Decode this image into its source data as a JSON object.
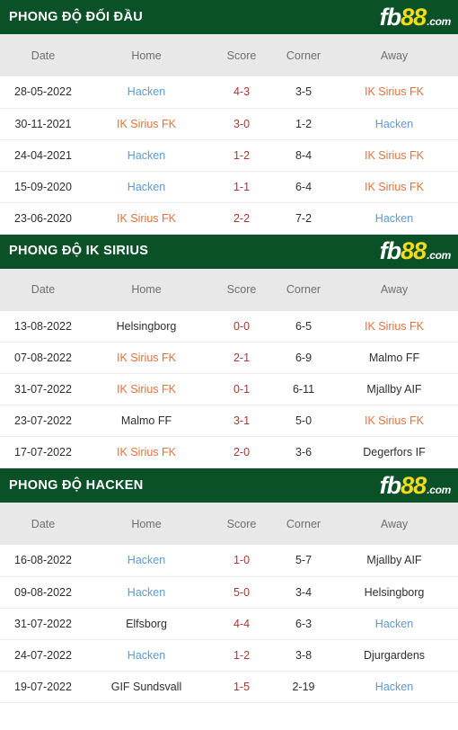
{
  "brand": {
    "logo_fb": "fb",
    "logo_88": "88",
    "logo_com": ".com",
    "green": "#0b5127",
    "yellow": "#f5dc16",
    "blue": "#5b9bd5",
    "orange": "#e4703c",
    "score_red": "#a33a33"
  },
  "columns": {
    "date": "Date",
    "home": "Home",
    "score": "Score",
    "corner": "Corner",
    "away": "Away"
  },
  "sections": [
    {
      "title": "PHONG ĐỘ ĐỐI ĐẦU",
      "rows": [
        {
          "date": "28-05-2022",
          "home": "Hacken",
          "home_style": "t-blue",
          "score": "4-3",
          "corner": "3-5",
          "away": "IK Sirius FK",
          "away_style": "t-orange"
        },
        {
          "date": "30-11-2021",
          "home": "IK Sirius FK",
          "home_style": "t-orange",
          "score": "3-0",
          "corner": "1-2",
          "away": "Hacken",
          "away_style": "t-blue"
        },
        {
          "date": "24-04-2021",
          "home": "Hacken",
          "home_style": "t-blue",
          "score": "1-2",
          "corner": "8-4",
          "away": "IK Sirius FK",
          "away_style": "t-orange"
        },
        {
          "date": "15-09-2020",
          "home": "Hacken",
          "home_style": "t-blue",
          "score": "1-1",
          "corner": "6-4",
          "away": "IK Sirius FK",
          "away_style": "t-orange"
        },
        {
          "date": "23-06-2020",
          "home": "IK Sirius FK",
          "home_style": "t-orange",
          "score": "2-2",
          "corner": "7-2",
          "away": "Hacken",
          "away_style": "t-blue"
        }
      ]
    },
    {
      "title": "PHONG ĐỘ IK SIRIUS",
      "rows": [
        {
          "date": "13-08-2022",
          "home": "Helsingborg",
          "home_style": "t-neutral",
          "score": "0-0",
          "corner": "6-5",
          "away": "IK Sirius FK",
          "away_style": "t-orange"
        },
        {
          "date": "07-08-2022",
          "home": "IK Sirius FK",
          "home_style": "t-orange",
          "score": "2-1",
          "corner": "6-9",
          "away": "Malmo FF",
          "away_style": "t-neutral"
        },
        {
          "date": "31-07-2022",
          "home": "IK Sirius FK",
          "home_style": "t-orange",
          "score": "0-1",
          "corner": "6-11",
          "away": "Mjallby AIF",
          "away_style": "t-neutral"
        },
        {
          "date": "23-07-2022",
          "home": "Malmo FF",
          "home_style": "t-neutral",
          "score": "3-1",
          "corner": "5-0",
          "away": "IK Sirius FK",
          "away_style": "t-orange"
        },
        {
          "date": "17-07-2022",
          "home": "IK Sirius FK",
          "home_style": "t-orange",
          "score": "2-0",
          "corner": "3-6",
          "away": "Degerfors IF",
          "away_style": "t-neutral"
        }
      ]
    },
    {
      "title": "PHONG ĐỘ HACKEN",
      "rows": [
        {
          "date": "16-08-2022",
          "home": "Hacken",
          "home_style": "t-blue",
          "score": "1-0",
          "corner": "5-7",
          "away": "Mjallby AIF",
          "away_style": "t-neutral"
        },
        {
          "date": "09-08-2022",
          "home": "Hacken",
          "home_style": "t-blue",
          "score": "5-0",
          "corner": "3-4",
          "away": "Helsingborg",
          "away_style": "t-neutral"
        },
        {
          "date": "31-07-2022",
          "home": "Elfsborg",
          "home_style": "t-neutral",
          "score": "4-4",
          "corner": "6-3",
          "away": "Hacken",
          "away_style": "t-blue"
        },
        {
          "date": "24-07-2022",
          "home": "Hacken",
          "home_style": "t-blue",
          "score": "1-2",
          "corner": "3-8",
          "away": "Djurgardens",
          "away_style": "t-neutral"
        },
        {
          "date": "19-07-2022",
          "home": "GIF Sundsvall",
          "home_style": "t-neutral",
          "score": "1-5",
          "corner": "2-19",
          "away": "Hacken",
          "away_style": "t-blue"
        }
      ]
    }
  ]
}
